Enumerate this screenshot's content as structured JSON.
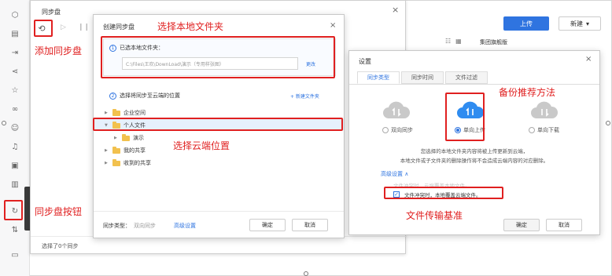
{
  "sync_window": {
    "title": "同步盘",
    "status": "选择了0个同步",
    "close_glyph": "×"
  },
  "background": {
    "upload_label": "上传",
    "new_label": "新建",
    "column_label": "集团旗舰版"
  },
  "create_dialog": {
    "title": "创建同步盘",
    "step1_label": "已选本地文件夹：",
    "path_value": "C:\\Files\\王欢\\DownLoad\\演示（专用样张图）",
    "change_link": "更改",
    "step2_label": "选择将同步至云端的位置",
    "new_folder_link": "+ 新建文件夹",
    "tree": [
      {
        "label": "企业空间"
      },
      {
        "label": "个人文件"
      },
      {
        "label": "演示"
      },
      {
        "label": "我的共享"
      },
      {
        "label": "收到的共享"
      }
    ],
    "sync_type_label": "同步类型：",
    "sync_type_value": "双向同步",
    "advanced_link": "高级设置",
    "ok_label": "确定",
    "cancel_label": "取消"
  },
  "settings_dialog": {
    "title": "设置",
    "tabs": [
      {
        "label": "同步类型"
      },
      {
        "label": "同步时间"
      },
      {
        "label": "文件过滤"
      }
    ],
    "options": [
      {
        "label": "双向同步"
      },
      {
        "label": "单向上传"
      },
      {
        "label": "单向下载"
      }
    ],
    "desc_line1": "您选择的本地文件夹内容将被上传更新到云端，",
    "desc_line2": "本地文件或子文件夹的删除操作将不会造成云端内容的对应删除。",
    "advanced_label": "高级设置 ∧",
    "faded_option": "文件冲突时，云端覆盖本地文件。",
    "checked_option": "文件冲突时，本地覆盖云端文件。",
    "ok_label": "确定",
    "cancel_label": "取消"
  },
  "annotations": {
    "add_sync": "添加同步盘",
    "choose_local": "选择本地文件夹",
    "choose_cloud": "选择云端位置",
    "backup_method": "备份推荐方法",
    "sync_button": "同步盘按钮",
    "transfer_basis": "文件传输基准",
    "color": "#e02020"
  },
  "icons": {
    "sidebar": [
      "logo-icon",
      "document-icon",
      "import-icon",
      "share-icon",
      "star-icon",
      "link-icon",
      "user-icon",
      "bell-icon",
      "trash-icon",
      "sync-icon",
      "transfer-icon",
      "feedback-icon"
    ]
  }
}
